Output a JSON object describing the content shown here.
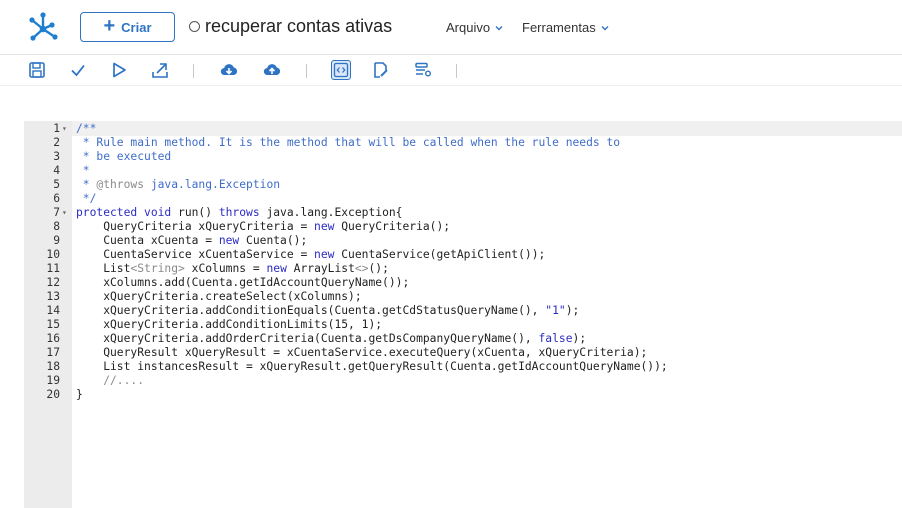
{
  "header": {
    "create_label": "Criar",
    "document_title": "recuperar contas ativas",
    "menus": [
      {
        "label": "Arquivo"
      },
      {
        "label": "Ferramentas"
      }
    ]
  },
  "toolbar": {
    "icons": [
      "save-icon",
      "check-icon",
      "play-icon",
      "export-icon",
      "cloud-download-icon",
      "cloud-upload-icon",
      "code-view-icon",
      "document-edit-icon",
      "list-settings-icon"
    ]
  },
  "colors": {
    "accent": "#2f73c4",
    "comment": "#3f6dc8",
    "keyword": "#2b2bc4",
    "gutter": "#ececec"
  },
  "editor": {
    "lines": [
      {
        "n": "1",
        "fold": "▾",
        "parts": [
          {
            "t": "/**",
            "c": "c-comment"
          }
        ]
      },
      {
        "n": "2",
        "fold": "",
        "parts": [
          {
            "t": " * Rule main method. It is the method that will be called when the rule needs to",
            "c": "c-comment"
          }
        ]
      },
      {
        "n": "3",
        "fold": "",
        "parts": [
          {
            "t": " * be executed",
            "c": "c-comment"
          }
        ]
      },
      {
        "n": "4",
        "fold": "",
        "parts": [
          {
            "t": " *",
            "c": "c-comment"
          }
        ]
      },
      {
        "n": "5",
        "fold": "",
        "parts": [
          {
            "t": " * ",
            "c": "c-comment"
          },
          {
            "t": "@throws",
            "c": "c-gray"
          },
          {
            "t": " java.lang.Exception",
            "c": "c-comment"
          }
        ]
      },
      {
        "n": "6",
        "fold": "",
        "parts": [
          {
            "t": " */",
            "c": "c-comment"
          }
        ]
      },
      {
        "n": "7",
        "fold": "▾",
        "parts": [
          {
            "t": "protected void",
            "c": "c-kw"
          },
          {
            "t": " run() ",
            "c": ""
          },
          {
            "t": "throws",
            "c": "c-kw"
          },
          {
            "t": " java.lang.Exception{",
            "c": ""
          }
        ]
      },
      {
        "n": "8",
        "fold": "",
        "parts": [
          {
            "t": "    QueryCriteria xQueryCriteria = ",
            "c": ""
          },
          {
            "t": "new",
            "c": "c-kw"
          },
          {
            "t": " QueryCriteria();",
            "c": ""
          }
        ]
      },
      {
        "n": "9",
        "fold": "",
        "parts": [
          {
            "t": "    Cuenta xCuenta = ",
            "c": ""
          },
          {
            "t": "new",
            "c": "c-kw"
          },
          {
            "t": " Cuenta();",
            "c": ""
          }
        ]
      },
      {
        "n": "10",
        "fold": "",
        "parts": [
          {
            "t": "    CuentaService xCuentaService = ",
            "c": ""
          },
          {
            "t": "new",
            "c": "c-kw"
          },
          {
            "t": " CuentaService(getApiClient());",
            "c": ""
          }
        ]
      },
      {
        "n": "11",
        "fold": "",
        "parts": [
          {
            "t": "    List",
            "c": ""
          },
          {
            "t": "<String>",
            "c": "c-gray"
          },
          {
            "t": " xColumns = ",
            "c": ""
          },
          {
            "t": "new",
            "c": "c-kw"
          },
          {
            "t": " ArrayList",
            "c": ""
          },
          {
            "t": "<>",
            "c": "c-gray"
          },
          {
            "t": "();",
            "c": ""
          }
        ]
      },
      {
        "n": "12",
        "fold": "",
        "parts": [
          {
            "t": "    xColumns.add(Cuenta.getIdAccountQueryName());",
            "c": ""
          }
        ]
      },
      {
        "n": "13",
        "fold": "",
        "parts": [
          {
            "t": "    xQueryCriteria.createSelect(xColumns);",
            "c": ""
          }
        ]
      },
      {
        "n": "14",
        "fold": "",
        "parts": [
          {
            "t": "    xQueryCriteria.addConditionEquals(Cuenta.getCdStatusQueryName(), ",
            "c": ""
          },
          {
            "t": "\"1\"",
            "c": "c-str"
          },
          {
            "t": ");",
            "c": ""
          }
        ]
      },
      {
        "n": "15",
        "fold": "",
        "parts": [
          {
            "t": "    xQueryCriteria.addConditionLimits(15, 1);",
            "c": ""
          }
        ]
      },
      {
        "n": "16",
        "fold": "",
        "parts": [
          {
            "t": "    xQueryCriteria.addOrderCriteria(Cuenta.getDsCompanyQueryName(), ",
            "c": ""
          },
          {
            "t": "false",
            "c": "c-kw"
          },
          {
            "t": ");",
            "c": ""
          }
        ]
      },
      {
        "n": "17",
        "fold": "",
        "parts": [
          {
            "t": "    QueryResult xQueryResult = xCuentaService.executeQuery(xCuenta, xQueryCriteria);",
            "c": ""
          }
        ]
      },
      {
        "n": "18",
        "fold": "",
        "parts": [
          {
            "t": "    List instancesResult = xQueryResult.getQueryResult(Cuenta.getIdAccountQueryName());",
            "c": ""
          }
        ]
      },
      {
        "n": "19",
        "fold": "",
        "parts": [
          {
            "t": "    //....",
            "c": "c-gray"
          }
        ]
      },
      {
        "n": "20",
        "fold": "",
        "parts": [
          {
            "t": "}",
            "c": ""
          }
        ]
      }
    ]
  }
}
